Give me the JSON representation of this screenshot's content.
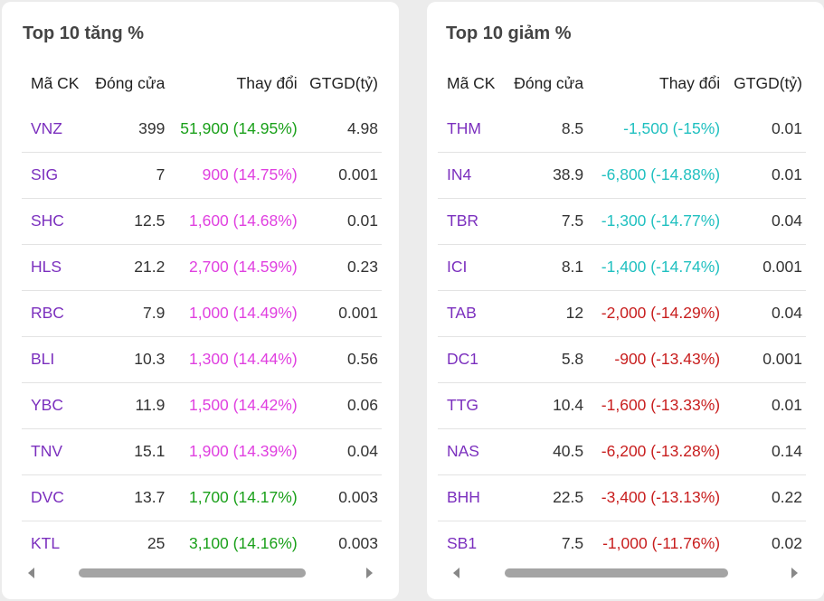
{
  "colors": {
    "symbol": "#7b2fbe",
    "ceiling": "#e040e0",
    "up": "#1aa01a",
    "floor": "#20c0c0",
    "down": "#c81e1e"
  },
  "gainers": {
    "title": "Top 10 tăng %",
    "headers": [
      "Mã CK",
      "Đóng cửa",
      "Thay đổi",
      "GTGD(tỷ)"
    ],
    "rows": [
      {
        "sym": "VNZ",
        "close": "399",
        "change": "51,900 (14.95%)",
        "value": "4.98",
        "color": "#1aa01a"
      },
      {
        "sym": "SIG",
        "close": "7",
        "change": "900 (14.75%)",
        "value": "0.001",
        "color": "#e040e0"
      },
      {
        "sym": "SHC",
        "close": "12.5",
        "change": "1,600 (14.68%)",
        "value": "0.01",
        "color": "#e040e0"
      },
      {
        "sym": "HLS",
        "close": "21.2",
        "change": "2,700 (14.59%)",
        "value": "0.23",
        "color": "#e040e0"
      },
      {
        "sym": "RBC",
        "close": "7.9",
        "change": "1,000 (14.49%)",
        "value": "0.001",
        "color": "#e040e0"
      },
      {
        "sym": "BLI",
        "close": "10.3",
        "change": "1,300 (14.44%)",
        "value": "0.56",
        "color": "#e040e0"
      },
      {
        "sym": "YBC",
        "close": "11.9",
        "change": "1,500 (14.42%)",
        "value": "0.06",
        "color": "#e040e0"
      },
      {
        "sym": "TNV",
        "close": "15.1",
        "change": "1,900 (14.39%)",
        "value": "0.04",
        "color": "#e040e0"
      },
      {
        "sym": "DVC",
        "close": "13.7",
        "change": "1,700 (14.17%)",
        "value": "0.003",
        "color": "#1aa01a"
      },
      {
        "sym": "KTL",
        "close": "25",
        "change": "3,100 (14.16%)",
        "value": "0.003",
        "color": "#1aa01a"
      }
    ]
  },
  "losers": {
    "title": "Top 10 giảm %",
    "headers": [
      "Mã CK",
      "Đóng cửa",
      "Thay đổi",
      "GTGD(tỷ)"
    ],
    "rows": [
      {
        "sym": "THM",
        "close": "8.5",
        "change": "-1,500 (-15%)",
        "value": "0.01",
        "color": "#20c0c0"
      },
      {
        "sym": "IN4",
        "close": "38.9",
        "change": "-6,800 (-14.88%)",
        "value": "0.01",
        "color": "#20c0c0"
      },
      {
        "sym": "TBR",
        "close": "7.5",
        "change": "-1,300 (-14.77%)",
        "value": "0.04",
        "color": "#20c0c0"
      },
      {
        "sym": "ICI",
        "close": "8.1",
        "change": "-1,400 (-14.74%)",
        "value": "0.001",
        "color": "#20c0c0"
      },
      {
        "sym": "TAB",
        "close": "12",
        "change": "-2,000 (-14.29%)",
        "value": "0.04",
        "color": "#c81e1e"
      },
      {
        "sym": "DC1",
        "close": "5.8",
        "change": "-900 (-13.43%)",
        "value": "0.001",
        "color": "#c81e1e"
      },
      {
        "sym": "TTG",
        "close": "10.4",
        "change": "-1,600 (-13.33%)",
        "value": "0.01",
        "color": "#c81e1e"
      },
      {
        "sym": "NAS",
        "close": "40.5",
        "change": "-6,200 (-13.28%)",
        "value": "0.14",
        "color": "#c81e1e"
      },
      {
        "sym": "BHH",
        "close": "22.5",
        "change": "-3,400 (-13.13%)",
        "value": "0.22",
        "color": "#c81e1e"
      },
      {
        "sym": "SB1",
        "close": "7.5",
        "change": "-1,000 (-11.76%)",
        "value": "0.02",
        "color": "#c81e1e"
      }
    ]
  }
}
